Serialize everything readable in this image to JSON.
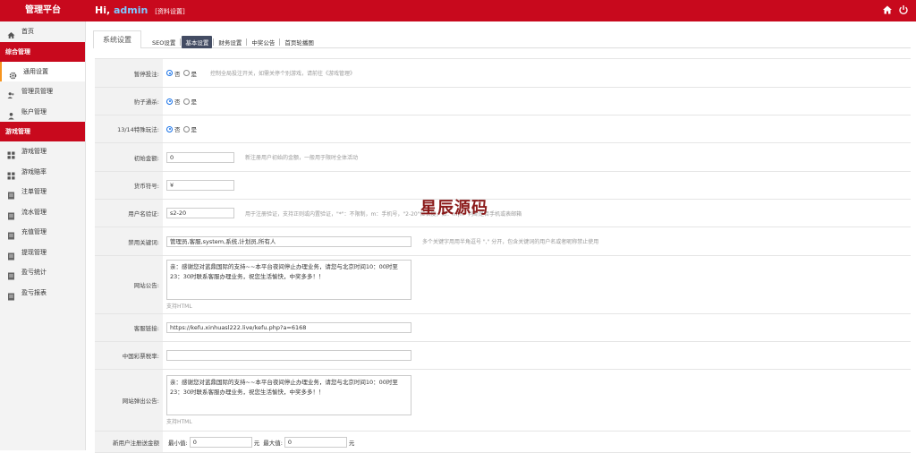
{
  "brand": "管理平台",
  "greeting": {
    "prefix": "Hi,",
    "user": "admin",
    "profile_link": "[资料设置]"
  },
  "sidebar": {
    "items_top": [
      {
        "label": "首页",
        "icon": "home-icon"
      }
    ],
    "group1": "综合管理",
    "group1_items": [
      {
        "label": "通用设置",
        "icon": "gear-icon"
      },
      {
        "label": "管理员管理",
        "icon": "users-icon"
      },
      {
        "label": "账户管理",
        "icon": "user-icon"
      }
    ],
    "group2": "游戏管理",
    "group2_items": [
      {
        "label": "游戏管理",
        "icon": "grid-icon"
      },
      {
        "label": "游戏赔率",
        "icon": "grid-icon"
      },
      {
        "label": "注单管理",
        "icon": "doc-icon"
      },
      {
        "label": "流水管理",
        "icon": "doc-icon"
      },
      {
        "label": "充值管理",
        "icon": "doc-icon"
      },
      {
        "label": "提现管理",
        "icon": "doc-icon"
      },
      {
        "label": "盈亏统计",
        "icon": "doc-icon"
      },
      {
        "label": "盈亏报表",
        "icon": "doc-icon"
      }
    ]
  },
  "tabs": {
    "main": "系统设置",
    "sub": [
      "SEO设置",
      "基本设置",
      "财务设置",
      "中奖公告",
      "首页轮播图"
    ],
    "active_sub": "基本设置"
  },
  "form": {
    "pause": {
      "label": "暂停投注:",
      "opt_no": "否",
      "opt_yes": "是",
      "hint": "控制全局投注开关，如需关停个别游戏，请前往《游戏管理》"
    },
    "leopard": {
      "label": "豹子通杀:",
      "opt_no": "否",
      "opt_yes": "是"
    },
    "special": {
      "label": "13/14特殊玩法:",
      "opt_no": "否",
      "opt_yes": "是"
    },
    "init_amount": {
      "label": "初始金额:",
      "value": "0",
      "hint": "新注册用户初始的金额，一般用于限时全体活动"
    },
    "currency": {
      "label": "货币符号:",
      "value": "¥"
    },
    "username_rule": {
      "label": "用户名验证:",
      "value": "s2-20",
      "hint": "用于注册验证，支持正则或内置验证，\"*\"：不限制，m：手机号，\"2-20\"位长度，如：m|n：判断是否手机或表邮箱"
    },
    "banned": {
      "label": "禁用关键词:",
      "value": "管理员,客服,system,系统,计划员,所有人",
      "hint": "多个关键字用用半角逗号 \",\" 分开，包含关键词的用户名或者昵称禁止使用"
    },
    "notice": {
      "label": "网站公告:",
      "value": "亲：感谢您对蓝鼎国际的支持~~本平台夜间停止办理业务，请您与北京时间10：00时至23：30时联系客服办理业务，祝您生活愉快，中奖多多！！",
      "support": "支持HTML"
    },
    "service": {
      "label": "客服链接:",
      "value": "https://kefu.xinhuasl222.live/kefu.php?a=6168"
    },
    "lottery": {
      "label": "中国彩票税率:",
      "value": ""
    },
    "popup": {
      "label": "网站弹出公告:",
      "value": "亲：感谢您对蓝鼎国际的支持~~本平台夜间停止办理业务，请您与北京时间10：00时至23：30时联系客服办理业务，祝您生活愉快，中奖多多！！",
      "support": "支持HTML"
    },
    "newuser": {
      "label": "新用户注册送金额",
      "min_label": "最小值:",
      "min_value": "0",
      "unit": "元",
      "max_label": "最大值:",
      "max_value": "0"
    }
  },
  "watermark": "星辰源码",
  "colors": {
    "topbar": "#c8091d",
    "accent": "#f7941e",
    "active_tab": "#434c63"
  }
}
